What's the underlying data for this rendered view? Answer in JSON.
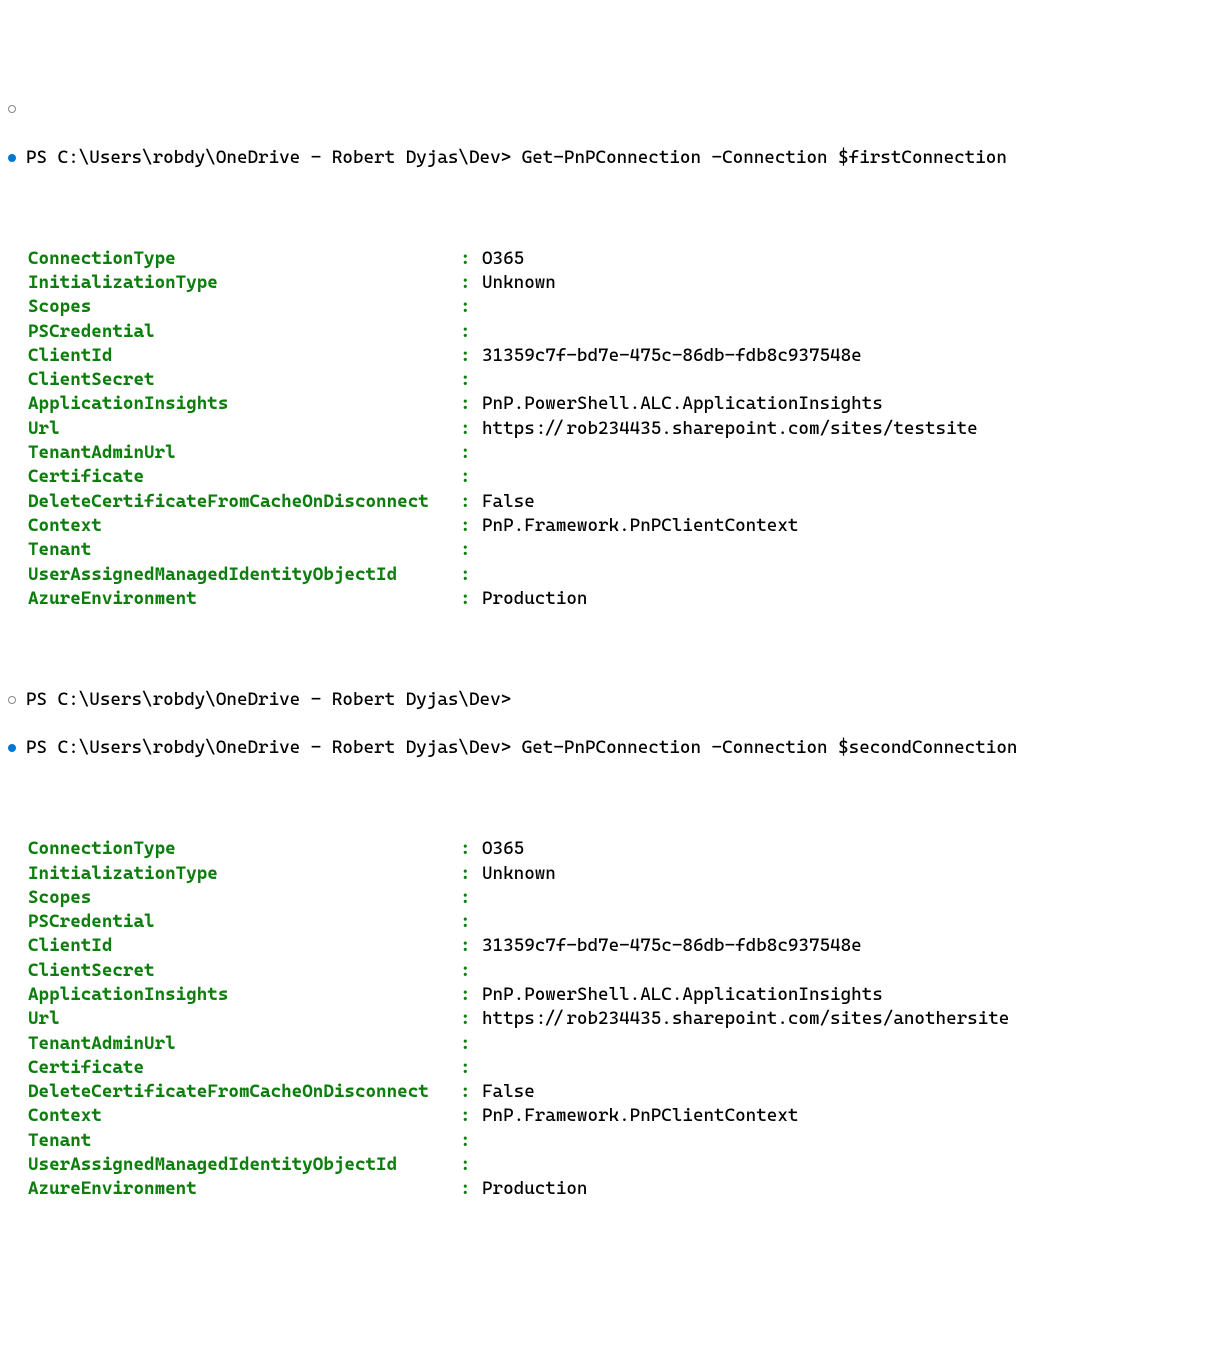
{
  "prompt_path": "PS C:\\Users\\robdy\\OneDrive - Robert Dyjas\\Dev>",
  "cutoff_line": "                            ",
  "commands": {
    "first": "Get-PnPConnection -Connection $firstConnection",
    "second": "Get-PnPConnection -Connection $secondConnection"
  },
  "blocks": [
    {
      "rows": [
        {
          "key": "ConnectionType",
          "val": "O365"
        },
        {
          "key": "InitializationType",
          "val": "Unknown"
        },
        {
          "key": "Scopes",
          "val": ""
        },
        {
          "key": "PSCredential",
          "val": ""
        },
        {
          "key": "ClientId",
          "val": "31359c7f-bd7e-475c-86db-fdb8c937548e"
        },
        {
          "key": "ClientSecret",
          "val": ""
        },
        {
          "key": "ApplicationInsights",
          "val": "PnP.PowerShell.ALC.ApplicationInsights"
        },
        {
          "key": "Url",
          "val": "https://rob234435.sharepoint.com/sites/testsite"
        },
        {
          "key": "TenantAdminUrl",
          "val": ""
        },
        {
          "key": "Certificate",
          "val": ""
        },
        {
          "key": "DeleteCertificateFromCacheOnDisconnect",
          "val": "False"
        },
        {
          "key": "Context",
          "val": "PnP.Framework.PnPClientContext"
        },
        {
          "key": "Tenant",
          "val": ""
        },
        {
          "key": "UserAssignedManagedIdentityObjectId",
          "val": ""
        },
        {
          "key": "AzureEnvironment",
          "val": "Production"
        }
      ]
    },
    {
      "rows": [
        {
          "key": "ConnectionType",
          "val": "O365"
        },
        {
          "key": "InitializationType",
          "val": "Unknown"
        },
        {
          "key": "Scopes",
          "val": ""
        },
        {
          "key": "PSCredential",
          "val": ""
        },
        {
          "key": "ClientId",
          "val": "31359c7f-bd7e-475c-86db-fdb8c937548e"
        },
        {
          "key": "ClientSecret",
          "val": ""
        },
        {
          "key": "ApplicationInsights",
          "val": "PnP.PowerShell.ALC.ApplicationInsights"
        },
        {
          "key": "Url",
          "val": "https://rob234435.sharepoint.com/sites/anothersite"
        },
        {
          "key": "TenantAdminUrl",
          "val": ""
        },
        {
          "key": "Certificate",
          "val": ""
        },
        {
          "key": "DeleteCertificateFromCacheOnDisconnect",
          "val": "False"
        },
        {
          "key": "Context",
          "val": "PnP.Framework.PnPClientContext"
        },
        {
          "key": "Tenant",
          "val": ""
        },
        {
          "key": "UserAssignedManagedIdentityObjectId",
          "val": ""
        },
        {
          "key": "AzureEnvironment",
          "val": "Production"
        }
      ]
    }
  ]
}
